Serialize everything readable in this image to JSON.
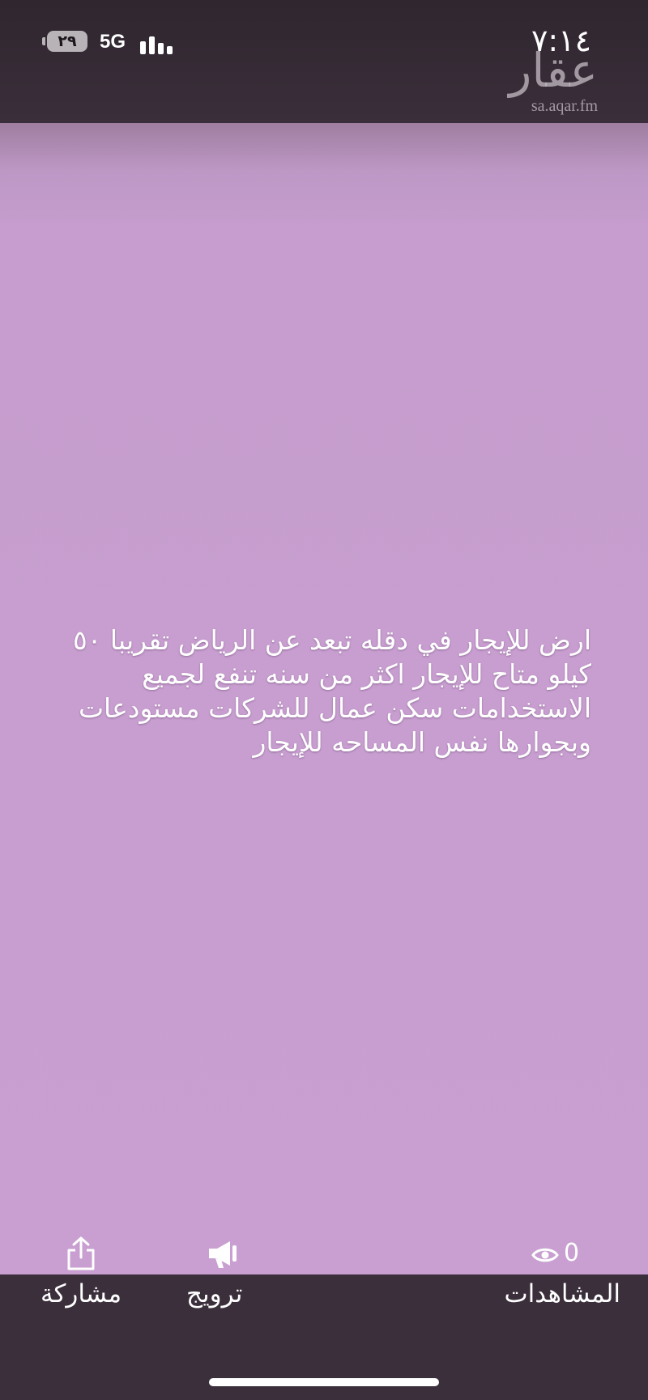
{
  "status_bar": {
    "time": "٧:١٤",
    "battery": "٢٩",
    "network": "5G"
  },
  "watermark": {
    "logo": "عقار",
    "url": "sa.aqar.fm"
  },
  "ad": {
    "lines": [
      "ارض للإيجار في دقله تبعد عن الرياض تقريبا ٥٠",
      "كيلو  متاح للإيجار اكثر من سنه تنفع لجميع",
      "الاستخدامات سكن عمال للشركات مستودعات",
      "وبجوارها نفس المساحه للإيجار"
    ]
  },
  "actions": {
    "share_label": "مشاركة",
    "promote_label": "ترويج",
    "views_label": "المشاهدات",
    "views_count": "0"
  },
  "icons": {
    "share": "share-icon",
    "promote": "megaphone-icon",
    "views": "eye-icon"
  }
}
